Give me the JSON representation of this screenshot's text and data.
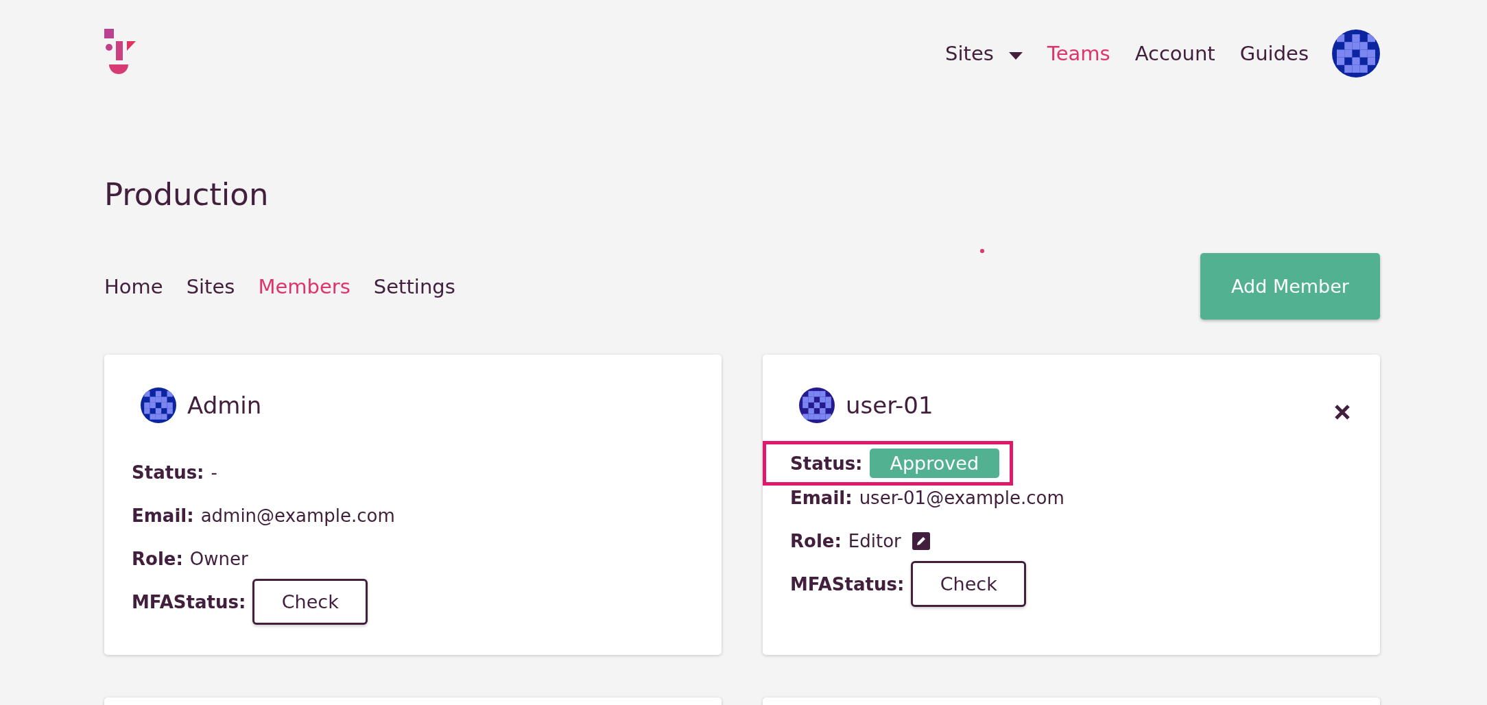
{
  "nav": [
    {
      "label": "Sites",
      "kind": "dropdown",
      "selected": false
    },
    {
      "label": "Teams",
      "kind": "link",
      "selected": true
    },
    {
      "label": "Account",
      "kind": "link",
      "selected": false
    },
    {
      "label": "Guides",
      "kind": "link",
      "selected": false
    }
  ],
  "page_title": "Production",
  "tabs": [
    {
      "label": "Home",
      "selected": false
    },
    {
      "label": "Sites",
      "selected": false
    },
    {
      "label": "Members",
      "selected": true
    },
    {
      "label": "Settings",
      "selected": false
    }
  ],
  "add_button": "Add Member",
  "members": [
    {
      "name": "Admin",
      "removable": false,
      "highlighted": false,
      "status_label": "Status:",
      "status": {
        "text": "-",
        "kind": "text"
      },
      "email_label": "Email:",
      "email": "admin@example.com",
      "role_label": "Role:",
      "role": "Owner",
      "role_editable": false,
      "mfa_label": "MFAStatus:",
      "mfa_button": "Check"
    },
    {
      "name": "user-01",
      "removable": true,
      "highlighted": true,
      "status_label": "Status:",
      "status": {
        "text": "Approved",
        "kind": "badge"
      },
      "email_label": "Email:",
      "email": "user-01@example.com",
      "role_label": "Role:",
      "role": "Editor",
      "role_editable": true,
      "mfa_label": "MFAStatus:",
      "mfa_button": "Check"
    }
  ]
}
